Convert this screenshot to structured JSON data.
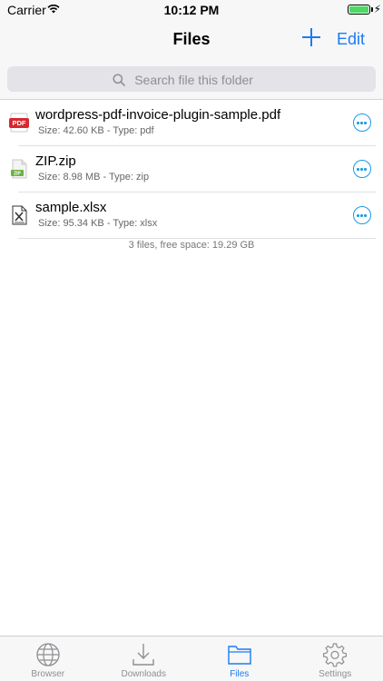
{
  "status_bar": {
    "carrier": "Carrier",
    "time": "10:12 PM"
  },
  "nav": {
    "title": "Files",
    "add_icon": "plus-icon",
    "edit_label": "Edit"
  },
  "search": {
    "placeholder": "Search file this folder"
  },
  "files": [
    {
      "name": "wordpress-pdf-invoice-plugin-sample.pdf",
      "meta": "Size: 42.60 KB - Type: pdf",
      "icon": "pdf-file-icon"
    },
    {
      "name": "ZIP.zip",
      "meta": "Size: 8.98 MB - Type: zip",
      "icon": "zip-file-icon"
    },
    {
      "name": "sample.xlsx",
      "meta": "Size: 95.34 KB - Type: xlsx",
      "icon": "excel-file-icon"
    }
  ],
  "footer": "3 files, free space: 19.29 GB",
  "tabs": [
    {
      "label": "Browser",
      "icon": "globe-icon",
      "active": false
    },
    {
      "label": "Downloads",
      "icon": "download-icon",
      "active": false
    },
    {
      "label": "Files",
      "icon": "folder-icon",
      "active": true
    },
    {
      "label": "Settings",
      "icon": "gear-icon",
      "active": false
    }
  ],
  "colors": {
    "accent": "#1a7cf5",
    "battery": "#4cd964",
    "pdf_badge": "#d7282f",
    "zip_badge": "#6cb33f"
  }
}
